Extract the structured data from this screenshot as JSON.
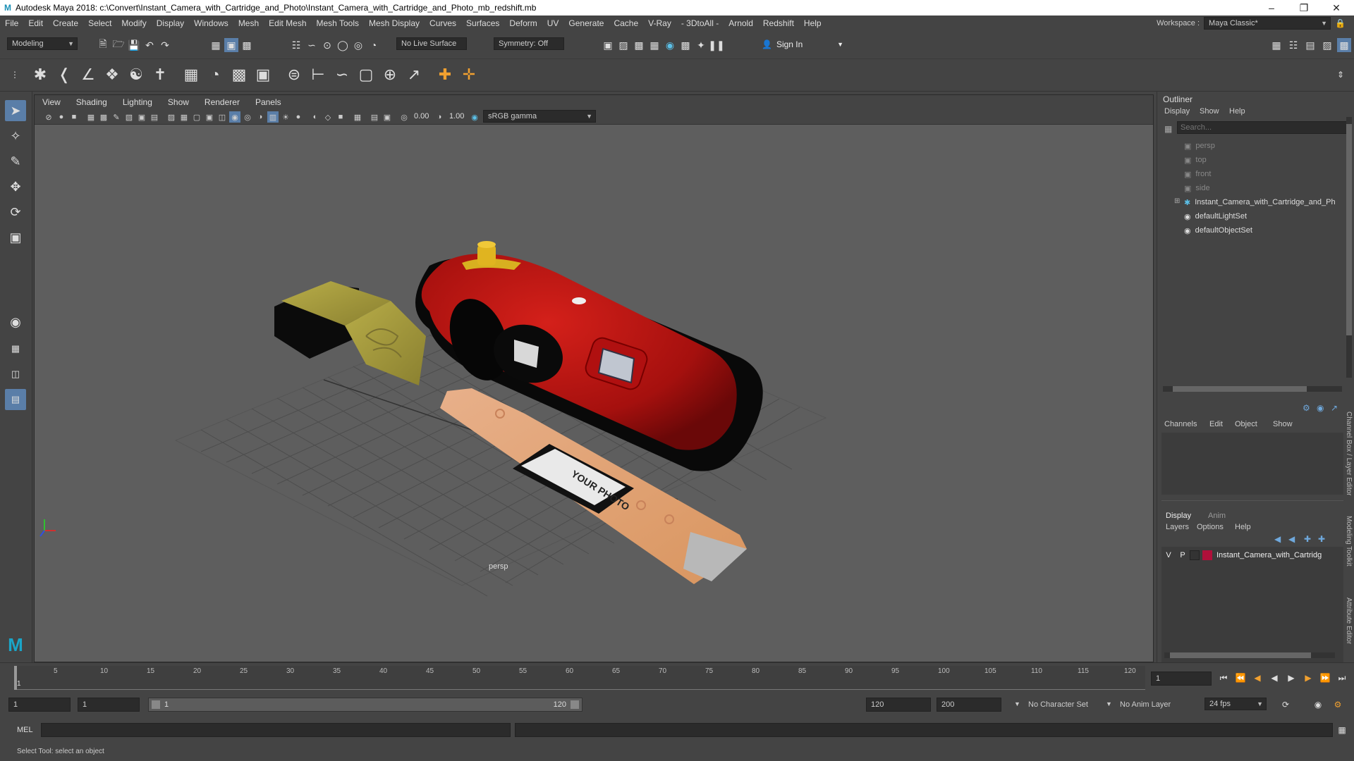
{
  "window": {
    "title": "Autodesk Maya 2018: c:\\Convert\\Instant_Camera_with_Cartridge_and_Photo\\Instant_Camera_with_Cartridge_and_Photo_mb_redshift.mb",
    "minimize_icon": "minimize-icon",
    "maximize_icon": "maximize-icon",
    "close_icon": "close-icon"
  },
  "menu": [
    "File",
    "Edit",
    "Create",
    "Select",
    "Modify",
    "Display",
    "Windows",
    "Mesh",
    "Edit Mesh",
    "Mesh Tools",
    "Mesh Display",
    "Curves",
    "Surfaces",
    "Deform",
    "UV",
    "Generate",
    "Cache",
    "V-Ray",
    "- 3DtoAll -",
    "Arnold",
    "Redshift",
    "Help"
  ],
  "workspace": {
    "label": "Workspace :",
    "value": "Maya Classic*"
  },
  "status": {
    "mode": "Modeling",
    "live_surface": "No Live Surface",
    "symmetry": "Symmetry: Off",
    "sign_in": "Sign In"
  },
  "viewport": {
    "menu": [
      "View",
      "Shading",
      "Lighting",
      "Show",
      "Renderer",
      "Panels"
    ],
    "exposure": "0.00",
    "gamma": "1.00",
    "color_space": "sRGB gamma",
    "camera_label": "persp",
    "photo_text": "YOUR PHOTO"
  },
  "outliner": {
    "title": "Outliner",
    "menu": [
      "Display",
      "Show",
      "Help"
    ],
    "search_placeholder": "Search...",
    "items": [
      {
        "label": "persp",
        "icon": "camera-icon",
        "dim": true
      },
      {
        "label": "top",
        "icon": "camera-icon",
        "dim": true
      },
      {
        "label": "front",
        "icon": "camera-icon",
        "dim": true
      },
      {
        "label": "side",
        "icon": "camera-icon",
        "dim": true
      },
      {
        "label": "Instant_Camera_with_Cartridge_and_Ph",
        "icon": "transform-icon",
        "dim": false
      },
      {
        "label": "defaultLightSet",
        "icon": "set-icon",
        "dim": false
      },
      {
        "label": "defaultObjectSet",
        "icon": "set-icon",
        "dim": false
      }
    ]
  },
  "channelbox": {
    "menu": [
      "Channels",
      "Edit",
      "Object",
      "Show"
    ],
    "layer_tabs": [
      "Display",
      "Anim"
    ],
    "layer_menu": [
      "Layers",
      "Options",
      "Help"
    ],
    "layer": {
      "v": "V",
      "p": "P",
      "name": "Instant_Camera_with_Cartridg",
      "color": "#b0103a"
    },
    "side_tabs": [
      "Channel Box / Layer Editor",
      "Modeling Toolkit",
      "Attribute Editor"
    ]
  },
  "timeline": {
    "ticks": [
      "5",
      "10",
      "15",
      "20",
      "25",
      "30",
      "35",
      "40",
      "45",
      "50",
      "55",
      "60",
      "65",
      "70",
      "75",
      "80",
      "85",
      "90",
      "95",
      "100",
      "105",
      "110",
      "115",
      "120"
    ],
    "start_marker": "1",
    "current_frame": "1"
  },
  "range": {
    "start": "1",
    "inner_start": "1",
    "slider_start": "1",
    "slider_end": "120",
    "end": "120",
    "total_end": "200",
    "character_set": "No Character Set",
    "anim_layer": "No Anim Layer",
    "fps": "24 fps"
  },
  "cmd": {
    "label": "MEL"
  },
  "help": {
    "text": "Select Tool: select an object"
  },
  "colors": {
    "camera_body": "#b01414",
    "cartridge": "#a59c3a",
    "photo_strip": "#e0a27a",
    "layer_swatch": "#b0103a"
  }
}
